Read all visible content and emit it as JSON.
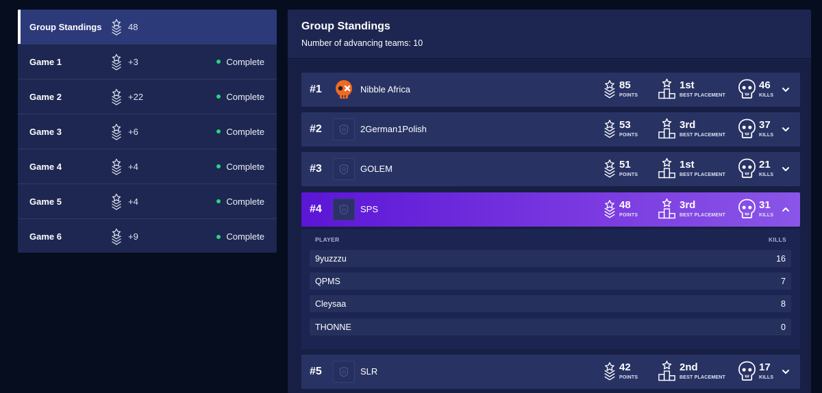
{
  "sidebar": {
    "items": [
      {
        "title": "Group Standings",
        "points": "48",
        "status": ""
      },
      {
        "title": "Game 1",
        "points": "+3",
        "status": "Complete"
      },
      {
        "title": "Game 2",
        "points": "+22",
        "status": "Complete"
      },
      {
        "title": "Game 3",
        "points": "+6",
        "status": "Complete"
      },
      {
        "title": "Game 4",
        "points": "+4",
        "status": "Complete"
      },
      {
        "title": "Game 5",
        "points": "+4",
        "status": "Complete"
      },
      {
        "title": "Game 6",
        "points": "+9",
        "status": "Complete"
      }
    ]
  },
  "main": {
    "title": "Group Standings",
    "subtitle": "Number of advancing teams: 10"
  },
  "labels": {
    "points": "POINTS",
    "best_placement": "BEST PLACEMENT",
    "kills": "KILLS",
    "player_col": "PLAYER",
    "kills_col": "KILLS"
  },
  "teams": [
    {
      "rank": "#1",
      "name": "Nibble Africa",
      "points": "85",
      "placement": "1st",
      "kills": "46",
      "logo": "nibble-skull-logo"
    },
    {
      "rank": "#2",
      "name": "2German1Polish",
      "points": "53",
      "placement": "3rd",
      "kills": "37",
      "logo": "default-shield-logo"
    },
    {
      "rank": "#3",
      "name": "GOLEM",
      "points": "51",
      "placement": "1st",
      "kills": "21",
      "logo": "default-shield-logo"
    },
    {
      "rank": "#4",
      "name": "SPS",
      "points": "48",
      "placement": "3rd",
      "kills": "31",
      "logo": "default-shield-logo"
    },
    {
      "rank": "#5",
      "name": "SLR",
      "points": "42",
      "placement": "2nd",
      "kills": "17",
      "logo": "default-shield-logo"
    }
  ],
  "expanded": {
    "players": [
      {
        "name": "9yuzzzu",
        "kills": "16"
      },
      {
        "name": "QPMS",
        "kills": "7"
      },
      {
        "name": "Cleysaa",
        "kills": "8"
      },
      {
        "name": "THONNE",
        "kills": "0"
      }
    ]
  },
  "colors": {
    "background": "#060d1f",
    "panel": "#1d2751",
    "row": "#283364",
    "active_row": "#6a25dc",
    "status_dot": "#27d67f"
  }
}
